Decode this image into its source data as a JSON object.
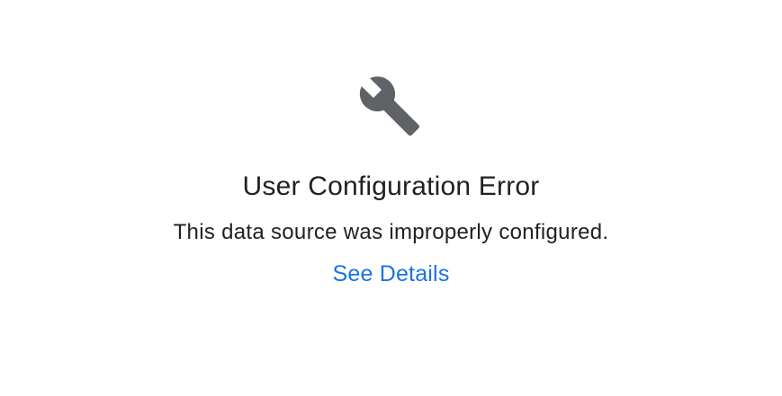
{
  "error": {
    "icon": "wrench-icon",
    "icon_color": "#5f6368",
    "title": "User Configuration Error",
    "message": "This data source was improperly configured.",
    "link_label": "See Details",
    "link_color": "#1a73e8"
  }
}
